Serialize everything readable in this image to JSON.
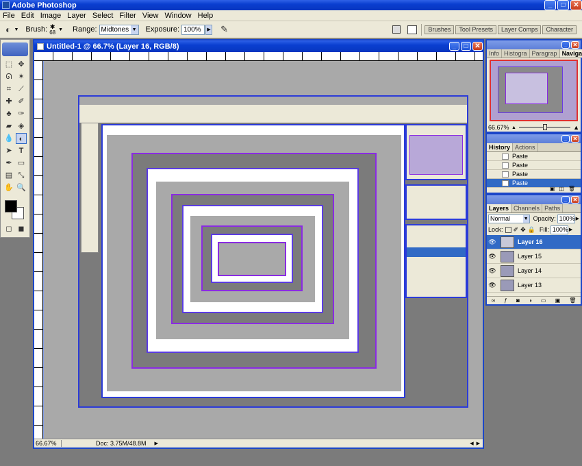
{
  "app": {
    "title": "Adobe Photoshop",
    "menus": [
      "File",
      "Edit",
      "Image",
      "Layer",
      "Select",
      "Filter",
      "View",
      "Window",
      "Help"
    ]
  },
  "options_bar": {
    "brush_label": "Brush:",
    "brush_size": "68",
    "range_label": "Range:",
    "range_value": "Midtones",
    "exposure_label": "Exposure:",
    "exposure_value": "100%",
    "dock_tabs": [
      "Brushes",
      "Tool Presets",
      "Layer Comps",
      "Character"
    ]
  },
  "document": {
    "title": "Untitled-1 @ 66.7% (Layer 16, RGB/8)",
    "zoom": "66.67%",
    "doc_size": "Doc: 3.75M/48.8M"
  },
  "navigator_panel": {
    "tabs": [
      "Info",
      "Histogra",
      "Paragrap",
      "Navigator"
    ],
    "zoom": "66.67%"
  },
  "history_panel": {
    "tabs": [
      "History",
      "Actions"
    ],
    "items": [
      "Paste",
      "Paste",
      "Paste",
      "Paste"
    ]
  },
  "layers_panel": {
    "tabs": [
      "Layers",
      "Channels",
      "Paths"
    ],
    "blend_mode": "Normal",
    "opacity_label": "Opacity:",
    "opacity_value": "100%",
    "lock_label": "Lock:",
    "fill_label": "Fill:",
    "fill_value": "100%",
    "layers": [
      "Layer 16",
      "Layer 15",
      "Layer 14",
      "Layer 13"
    ]
  },
  "colors": {
    "title_blue": "#0a3fd0",
    "selection_blue": "#316ac5",
    "panel_bg": "#ece9d8",
    "canvas_gray": "#a9a9a9"
  }
}
